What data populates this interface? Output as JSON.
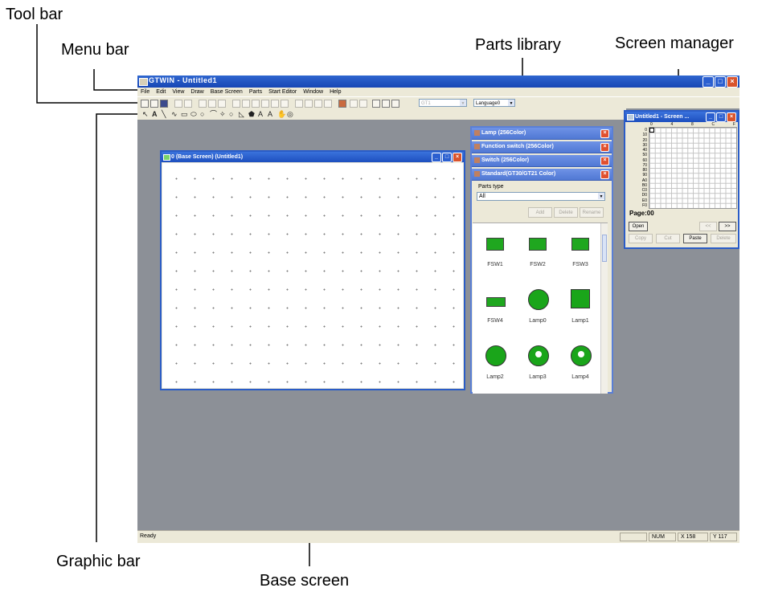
{
  "callouts": {
    "tool_bar": "Tool bar",
    "menu_bar": "Menu bar",
    "parts_library": "Parts library",
    "screen_manager": "Screen manager",
    "graphic_bar": "Graphic bar",
    "base_screen": "Base screen"
  },
  "app": {
    "title": "GTWIN - Untitled1",
    "menu": [
      "File",
      "Edit",
      "View",
      "Draw",
      "Base Screen",
      "Parts",
      "Start Editor",
      "Window",
      "Help"
    ],
    "toolbar": {
      "combo_value": "GT1",
      "language": "Language0"
    },
    "graphic_tools": [
      "↖",
      "A",
      "╲",
      "∿",
      "▭",
      "⬭",
      "○",
      "⌒",
      "✧",
      "○",
      "◺",
      "⬟",
      "A",
      "A",
      "✋",
      "◎"
    ],
    "status": {
      "left": "Ready",
      "num": "NUM",
      "x": "X 158",
      "y": "Y 117"
    }
  },
  "base_screen": {
    "title": "0 (Base Screen) (Untitled1)"
  },
  "parts_library": {
    "panels": [
      "Lamp (256Color)",
      "Function switch (256Color)",
      "Switch (256Color)",
      "Standard(GT30/GT21 Color)"
    ],
    "parts_type_label": "Parts type",
    "parts_type_value": "All",
    "buttons": [
      "Add",
      "Delete",
      "Rename"
    ],
    "items": [
      {
        "label": "FSW1",
        "kind": "fsw"
      },
      {
        "label": "FSW2",
        "kind": "fsw"
      },
      {
        "label": "FSW3",
        "kind": "fsw"
      },
      {
        "label": "FSW4",
        "kind": "fsw"
      },
      {
        "label": "Lamp0",
        "kind": "circle"
      },
      {
        "label": "Lamp1",
        "kind": "square"
      },
      {
        "label": "Lamp2",
        "kind": "circle"
      },
      {
        "label": "Lamp3",
        "kind": "white"
      },
      {
        "label": "Lamp4",
        "kind": "white"
      }
    ]
  },
  "screen_manager": {
    "title": "Untitled1 - Screen ...",
    "col_headers": [
      "0",
      "4",
      "8",
      "C",
      "F"
    ],
    "row_headers": [
      "0",
      "10",
      "20",
      "30",
      "40",
      "50",
      "60",
      "70",
      "80",
      "90",
      "A0",
      "B0",
      "C0",
      "D0",
      "E0",
      "F0"
    ],
    "page": "Page:00",
    "buttons": {
      "open": "Open",
      "prev": "<<",
      "next": ">>",
      "copy": "Copy",
      "cut": "Cut",
      "paste": "Paste",
      "delete": "Delete"
    }
  }
}
